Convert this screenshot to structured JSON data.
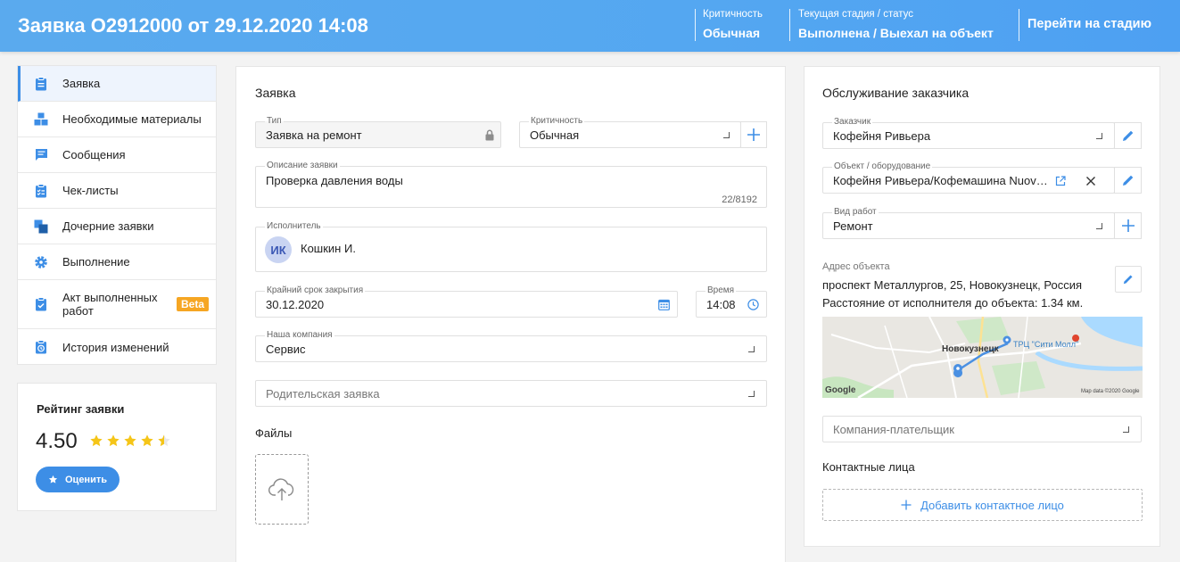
{
  "header": {
    "title": "Заявка О2912000 от 29.12.2020 14:08",
    "criticality_label": "Критичность",
    "criticality_value": "Обычная",
    "stage_label": "Текущая стадия / статус",
    "stage_value": "Выполнена / Выехал на объект",
    "goto_stage": "Перейти на стадию"
  },
  "sidebar": {
    "items": [
      {
        "label": "Заявка",
        "icon": "clipboard-icon",
        "active": true
      },
      {
        "label": "Необходимые материалы",
        "icon": "boxes-icon"
      },
      {
        "label": "Сообщения",
        "icon": "message-icon"
      },
      {
        "label": "Чек-листы",
        "icon": "checklist-icon"
      },
      {
        "label": "Дочерние заявки",
        "icon": "child-requests-icon"
      },
      {
        "label": "Выполнение",
        "icon": "gear-icon"
      },
      {
        "label": "Акт выполненных работ",
        "icon": "act-icon",
        "badge": "Beta"
      },
      {
        "label": "История изменений",
        "icon": "history-icon"
      }
    ]
  },
  "rating": {
    "title": "Рейтинг заявки",
    "value": "4.50",
    "stars": 4.5,
    "button": "Оценить"
  },
  "request": {
    "title": "Заявка",
    "type": {
      "label": "Тип",
      "value": "Заявка на ремонт"
    },
    "criticality": {
      "label": "Критичность",
      "value": "Обычная"
    },
    "description": {
      "label": "Описание заявки",
      "value": "Проверка давления воды",
      "counter": "22/8192"
    },
    "executor": {
      "label": "Исполнитель",
      "initials": "ИК",
      "value": "Кошкин И."
    },
    "deadline": {
      "label": "Крайний срок закрытия",
      "value": "30.12.2020"
    },
    "time": {
      "label": "Время",
      "value": "14:08"
    },
    "company": {
      "label": "Наша компания",
      "value": "Сервис"
    },
    "parent": {
      "placeholder": "Родительская заявка"
    },
    "files_title": "Файлы"
  },
  "customer": {
    "title": "Обслуживание заказчика",
    "customer": {
      "label": "Заказчик",
      "value": "Кофейня Ривьера"
    },
    "object": {
      "label": "Объект / оборудование",
      "value": "Кофейня Ривьера/Кофемашина Nuov…"
    },
    "work_type": {
      "label": "Вид работ",
      "value": "Ремонт"
    },
    "address_label": "Адрес объекта",
    "address": "проспект Металлургов, 25, Новокузнецк, Россия",
    "distance": "Расстояние от исполнителя до объекта: 1.34 км.",
    "map": {
      "city": "Новокузнецк",
      "poi": "ТРЦ \"Сити Молл\"",
      "logo": "Google",
      "attribution": "Map data ©2020 Google"
    },
    "payer": {
      "placeholder": "Компания-плательщик"
    },
    "contacts_title": "Контактные лица",
    "add_contact": "Добавить контактное лицо"
  },
  "colors": {
    "header": "#54a7f1",
    "accent": "#3d8ee6",
    "beta": "#f6a623",
    "star": "#f5c518"
  }
}
